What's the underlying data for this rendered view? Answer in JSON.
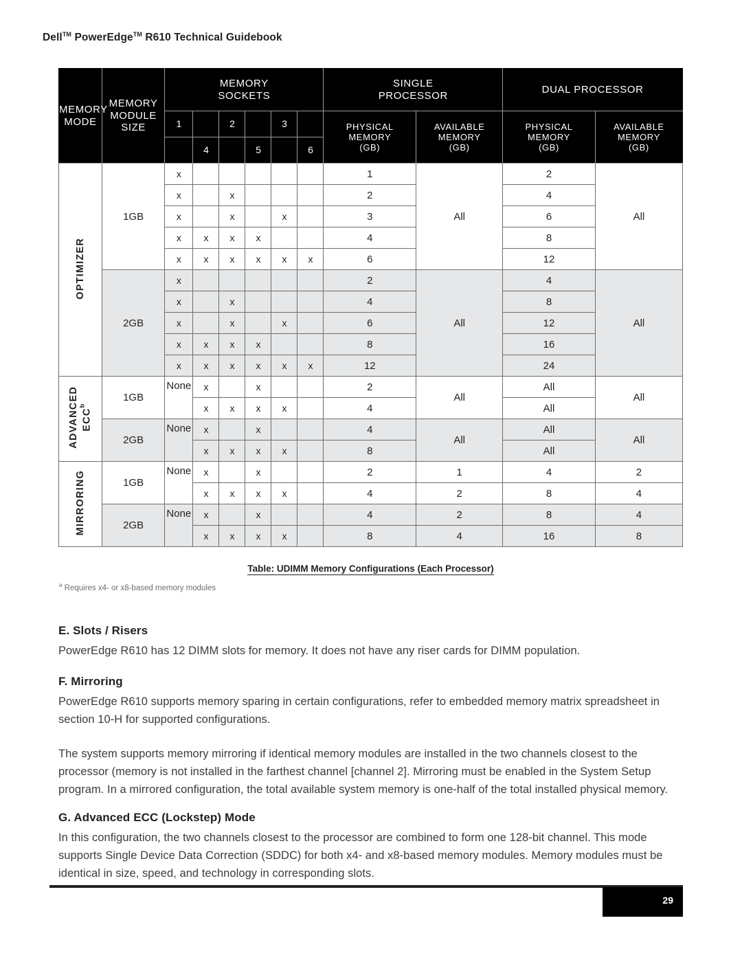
{
  "running_head": {
    "prefix": "Dell",
    "tm1": "TM",
    "mid": " PowerEdge",
    "tm2": "TM",
    "suffix": " R610 Technical Guidebook"
  },
  "table": {
    "headers": {
      "memory_mode": "MEMORY\nMODE",
      "memory_mode_l1": "MEMORY",
      "memory_mode_l2": "MODE",
      "memory_module_size_l1": "MEMORY",
      "memory_module_size_l2": "MODULE",
      "memory_module_size_l3": "SIZE",
      "memory_sockets_l1": "MEMORY",
      "memory_sockets_l2": "SOCKETS",
      "socket_top": [
        "1",
        "2",
        "3"
      ],
      "socket_bottom": [
        "4",
        "5",
        "6"
      ],
      "single_processor_l1": "SINGLE",
      "single_processor_l2": "PROCESSOR",
      "dual_processor": "DUAL PROCESSOR",
      "physical_memory_l1": "PHYSICAL",
      "physical_memory_l2": "MEMORY",
      "physical_memory_l3": "(GB)",
      "available_memory_l1": "AVAILABLE",
      "available_memory_l2": "MEMORY",
      "available_memory_l3": "(GB)"
    },
    "x_mark": "x",
    "none_label": "None",
    "all_label": "All",
    "groups": [
      {
        "mode": "OPTIMIZER",
        "mode_sup": "",
        "sizes": [
          {
            "size": "1GB",
            "shaded": false,
            "sp_available": "All",
            "dp_available": "All",
            "rows": [
              {
                "sockets": [
                  "x",
                  "",
                  "",
                  "",
                  "",
                  ""
                ],
                "sp_physical": "1",
                "dp_physical": "2"
              },
              {
                "sockets": [
                  "x",
                  "",
                  "x",
                  "",
                  "",
                  ""
                ],
                "sp_physical": "2",
                "dp_physical": "4"
              },
              {
                "sockets": [
                  "x",
                  "",
                  "x",
                  "",
                  "x",
                  ""
                ],
                "sp_physical": "3",
                "dp_physical": "6"
              },
              {
                "sockets": [
                  "x",
                  "x",
                  "x",
                  "x",
                  "",
                  ""
                ],
                "sp_physical": "4",
                "dp_physical": "8"
              },
              {
                "sockets": [
                  "x",
                  "x",
                  "x",
                  "x",
                  "x",
                  "x"
                ],
                "sp_physical": "6",
                "dp_physical": "12"
              }
            ]
          },
          {
            "size": "2GB",
            "shaded": true,
            "sp_available": "All",
            "dp_available": "All",
            "rows": [
              {
                "sockets": [
                  "x",
                  "",
                  "",
                  "",
                  "",
                  ""
                ],
                "sp_physical": "2",
                "dp_physical": "4"
              },
              {
                "sockets": [
                  "x",
                  "",
                  "x",
                  "",
                  "",
                  ""
                ],
                "sp_physical": "4",
                "dp_physical": "8"
              },
              {
                "sockets": [
                  "x",
                  "",
                  "x",
                  "",
                  "x",
                  ""
                ],
                "sp_physical": "6",
                "dp_physical": "12"
              },
              {
                "sockets": [
                  "x",
                  "x",
                  "x",
                  "x",
                  "",
                  ""
                ],
                "sp_physical": "8",
                "dp_physical": "16"
              },
              {
                "sockets": [
                  "x",
                  "x",
                  "x",
                  "x",
                  "x",
                  "x"
                ],
                "sp_physical": "12",
                "dp_physical": "24"
              }
            ]
          }
        ]
      },
      {
        "mode": "ADVANCED",
        "mode_l2": "ECC",
        "mode_sup": "b",
        "sizes": [
          {
            "size": "1GB",
            "shaded": false,
            "sp_available": "All",
            "dp_available": "All",
            "rows": [
              {
                "none": "None",
                "sockets": [
                  "",
                  "x",
                  "",
                  "x",
                  "",
                  ""
                ],
                "sp_physical": "2",
                "dp_physical": "All"
              },
              {
                "none": "",
                "sockets": [
                  "",
                  "x",
                  "x",
                  "x",
                  "x",
                  ""
                ],
                "sp_physical": "4",
                "dp_physical": "All"
              }
            ]
          },
          {
            "size": "2GB",
            "shaded": true,
            "sp_available": "All",
            "dp_available": "All",
            "rows": [
              {
                "none": "None",
                "sockets": [
                  "",
                  "x",
                  "",
                  "x",
                  "",
                  ""
                ],
                "sp_physical": "4",
                "dp_physical": "All"
              },
              {
                "none": "",
                "sockets": [
                  "",
                  "x",
                  "x",
                  "x",
                  "x",
                  ""
                ],
                "sp_physical": "8",
                "dp_physical": "All"
              }
            ]
          }
        ]
      },
      {
        "mode": "MIRRORING",
        "mode_sup": "",
        "sizes": [
          {
            "size": "1GB",
            "shaded": false,
            "rows": [
              {
                "none": "None",
                "sockets": [
                  "",
                  "x",
                  "",
                  "x",
                  "",
                  ""
                ],
                "sp_physical": "2",
                "sp_available": "1",
                "dp_physical": "4",
                "dp_available": "2"
              },
              {
                "none": "",
                "sockets": [
                  "",
                  "x",
                  "x",
                  "x",
                  "x",
                  ""
                ],
                "sp_physical": "4",
                "sp_available": "2",
                "dp_physical": "8",
                "dp_available": "4"
              }
            ]
          },
          {
            "size": "2GB",
            "shaded": true,
            "rows": [
              {
                "none": "None",
                "sockets": [
                  "",
                  "x",
                  "",
                  "x",
                  "",
                  ""
                ],
                "sp_physical": "4",
                "sp_available": "2",
                "dp_physical": "8",
                "dp_available": "4"
              },
              {
                "none": "",
                "sockets": [
                  "",
                  "x",
                  "x",
                  "x",
                  "x",
                  ""
                ],
                "sp_physical": "8",
                "sp_available": "4",
                "dp_physical": "16",
                "dp_available": "8"
              }
            ]
          }
        ]
      }
    ],
    "caption": "Table: UDIMM Memory Configurations (Each Processor)",
    "footnote_marker": "a",
    "footnote": " Requires x4- or x8-based memory modules"
  },
  "sections": [
    {
      "heading": "E. Slots / Risers",
      "paragraphs": [
        "PowerEdge R610 has 12 DIMM slots for memory. It does not have any riser cards for DIMM population."
      ]
    },
    {
      "heading": "F. Mirroring",
      "paragraphs": [
        "PowerEdge R610 supports memory sparing in certain configurations, refer to embedded memory matrix spreadsheet in section 10-H for supported configurations.",
        "The system supports memory mirroring if identical memory modules are installed in the two channels closest to the processor (memory is not installed in the farthest channel [channel 2]. Mirroring must be enabled in the System Setup program. In a mirrored configuration, the total available system memory is one-half of the total installed physical memory."
      ]
    },
    {
      "heading": "G. Advanced ECC (Lockstep) Mode",
      "paragraphs": [
        "In this configuration, the two channels closest to the processor are combined to form one 128-bit channel. This mode supports Single Device Data Correction (SDDC) for both x4- and x8-based memory modules. Memory modules must be identical in size, speed, and technology in corresponding slots."
      ]
    }
  ],
  "footer": {
    "page_number": "29"
  },
  "colors": {
    "header_bg": "#000000",
    "header_fg": "#ffffff",
    "shade_bg": "#e6e7e8",
    "rule": "#231f20",
    "body_text": "#3c3c3c"
  }
}
